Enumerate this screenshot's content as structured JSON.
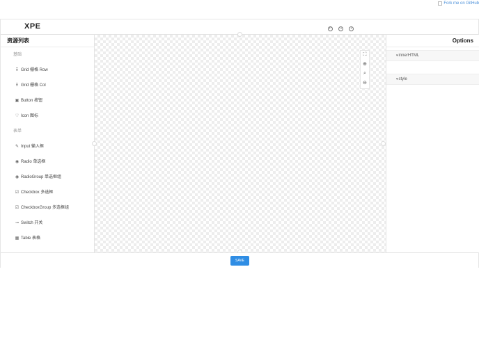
{
  "ribbon": {
    "alt_text": "Fork me on GitHub"
  },
  "header": {
    "logo": "XPE",
    "icons": [
      "undo-icon",
      "code-icon",
      "preview-eye-icon"
    ]
  },
  "resources": {
    "title": "资源列表",
    "groups": [
      {
        "label": "基础",
        "items": [
          {
            "icon": "grid-icon",
            "glyph": "⠿",
            "label": "Grid 栅格 Row"
          },
          {
            "icon": "grid-icon",
            "glyph": "⠿",
            "label": "Grid 栅格 Col"
          },
          {
            "icon": "button-icon",
            "glyph": "▣",
            "label": "Button 按钮"
          },
          {
            "icon": "heart-icon",
            "glyph": "♡",
            "label": "Icon 图标"
          }
        ]
      },
      {
        "label": "表单",
        "items": [
          {
            "icon": "edit-icon",
            "glyph": "✎",
            "label": "Input 输入框"
          },
          {
            "icon": "radio-icon",
            "glyph": "◉",
            "label": "Radio 单选框"
          },
          {
            "icon": "radio-icon",
            "glyph": "◉",
            "label": "RadioGroup 单选框组"
          },
          {
            "icon": "checkbox-icon",
            "glyph": "☑",
            "label": "Checkbox 多选框"
          },
          {
            "icon": "checkbox-icon",
            "glyph": "☑",
            "label": "CheckboxGroup 多选框组"
          },
          {
            "icon": "switch-icon",
            "glyph": "⊸",
            "label": "Switch 开关"
          },
          {
            "icon": "table-icon",
            "glyph": "▦",
            "label": "Table 表格"
          }
        ]
      }
    ]
  },
  "zoom_tools": [
    {
      "name": "fullscreen-icon",
      "glyph": "⛶"
    },
    {
      "name": "zoom-in-icon",
      "glyph": "⊕"
    },
    {
      "name": "zoom-reset-icon",
      "glyph": "⌕"
    },
    {
      "name": "zoom-out-icon",
      "glyph": "⊖"
    }
  ],
  "options": {
    "title": "Options",
    "sections": [
      {
        "label": "innerHTML"
      },
      {
        "label": "style"
      }
    ]
  },
  "footer": {
    "save_label": "SAVE"
  }
}
